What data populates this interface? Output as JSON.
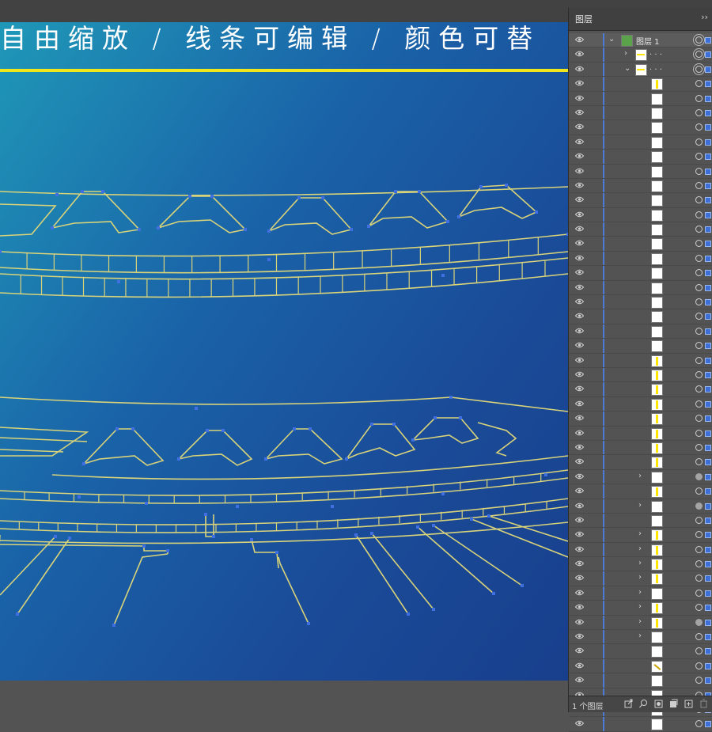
{
  "canvas": {
    "headline": "自由缩放 / 线条可编辑 / 颜色可替",
    "colors": {
      "line_yellow": "#f1e51c",
      "anchor_blue": "#3f6fe0",
      "bg_start": "#1f98b8",
      "bg_end": "#183f8c"
    }
  },
  "layers_panel": {
    "tab_label": "图层",
    "collapse_icon": "double-chevron-right-icon",
    "menu_icon": "panel-menu-icon",
    "top_layer_name": "图层 1",
    "group_name_dots": ". . .",
    "footer_label": "1 个图层",
    "footer_icons": [
      "export-icon",
      "locate-object-icon",
      "make-clipping-mask-icon",
      "new-sublayer-icon",
      "new-layer-icon",
      "delete-icon"
    ],
    "rows": [
      {
        "type": "layer",
        "twirl": "down",
        "target": "double"
      },
      {
        "type": "group",
        "twirl": "right",
        "target": "double"
      },
      {
        "type": "group",
        "twirl": "down",
        "target": "double"
      },
      {
        "type": "path",
        "twirl": "",
        "target": "ring",
        "thumb": "mark"
      },
      {
        "type": "path",
        "twirl": "",
        "target": "ring",
        "thumb": "plain"
      },
      {
        "type": "path",
        "twirl": "",
        "target": "ring",
        "thumb": "plain"
      },
      {
        "type": "path",
        "twirl": "",
        "target": "ring",
        "thumb": "plain"
      },
      {
        "type": "path",
        "twirl": "",
        "target": "ring",
        "thumb": "plain"
      },
      {
        "type": "path",
        "twirl": "",
        "target": "ring",
        "thumb": "plain"
      },
      {
        "type": "path",
        "twirl": "",
        "target": "ring",
        "thumb": "plain"
      },
      {
        "type": "path",
        "twirl": "",
        "target": "ring",
        "thumb": "plain"
      },
      {
        "type": "path",
        "twirl": "",
        "target": "ring",
        "thumb": "plain"
      },
      {
        "type": "path",
        "twirl": "",
        "target": "ring",
        "thumb": "plain"
      },
      {
        "type": "path",
        "twirl": "",
        "target": "ring",
        "thumb": "plain"
      },
      {
        "type": "path",
        "twirl": "",
        "target": "ring",
        "thumb": "plain"
      },
      {
        "type": "path",
        "twirl": "",
        "target": "ring",
        "thumb": "plain"
      },
      {
        "type": "path",
        "twirl": "",
        "target": "ring",
        "thumb": "plain"
      },
      {
        "type": "path",
        "twirl": "",
        "target": "ring",
        "thumb": "plain"
      },
      {
        "type": "path",
        "twirl": "",
        "target": "ring",
        "thumb": "plain"
      },
      {
        "type": "path",
        "twirl": "",
        "target": "ring",
        "thumb": "plain"
      },
      {
        "type": "path",
        "twirl": "",
        "target": "ring",
        "thumb": "plain"
      },
      {
        "type": "path",
        "twirl": "",
        "target": "ring",
        "thumb": "plain"
      },
      {
        "type": "path",
        "twirl": "",
        "target": "ring",
        "thumb": "mark"
      },
      {
        "type": "path",
        "twirl": "",
        "target": "ring",
        "thumb": "mark"
      },
      {
        "type": "path",
        "twirl": "",
        "target": "ring",
        "thumb": "mark"
      },
      {
        "type": "path",
        "twirl": "",
        "target": "ring",
        "thumb": "mark"
      },
      {
        "type": "path",
        "twirl": "",
        "target": "ring",
        "thumb": "mark"
      },
      {
        "type": "path",
        "twirl": "",
        "target": "ring",
        "thumb": "mark"
      },
      {
        "type": "path",
        "twirl": "",
        "target": "ring",
        "thumb": "mark"
      },
      {
        "type": "path",
        "twirl": "",
        "target": "ring",
        "thumb": "mark"
      },
      {
        "type": "group",
        "twirl": "right",
        "target": "filled",
        "thumb": "plain"
      },
      {
        "type": "path",
        "twirl": "",
        "target": "ring",
        "thumb": "mark"
      },
      {
        "type": "group",
        "twirl": "right",
        "target": "filled",
        "thumb": "plain"
      },
      {
        "type": "path",
        "twirl": "",
        "target": "ring",
        "thumb": "plain"
      },
      {
        "type": "group",
        "twirl": "right",
        "target": "ring",
        "thumb": "mark"
      },
      {
        "type": "group",
        "twirl": "right",
        "target": "ring",
        "thumb": "mark"
      },
      {
        "type": "group",
        "twirl": "right",
        "target": "ring",
        "thumb": "mark"
      },
      {
        "type": "group",
        "twirl": "right",
        "target": "ring",
        "thumb": "mark"
      },
      {
        "type": "group",
        "twirl": "right",
        "target": "ring",
        "thumb": "plain"
      },
      {
        "type": "group",
        "twirl": "right",
        "target": "ring",
        "thumb": "mark"
      },
      {
        "type": "group",
        "twirl": "right",
        "target": "filled",
        "thumb": "mark"
      },
      {
        "type": "group",
        "twirl": "right",
        "target": "ring",
        "thumb": "plain"
      },
      {
        "type": "path",
        "twirl": "",
        "target": "ring",
        "thumb": "plain"
      },
      {
        "type": "path",
        "twirl": "",
        "target": "ring",
        "thumb": "slash"
      },
      {
        "type": "path",
        "twirl": "",
        "target": "ring",
        "thumb": "plain"
      },
      {
        "type": "path",
        "twirl": "",
        "target": "ring",
        "thumb": "plain"
      },
      {
        "type": "path",
        "twirl": "",
        "target": "ring",
        "thumb": "plain"
      },
      {
        "type": "path",
        "twirl": "",
        "target": "ring",
        "thumb": "plain"
      }
    ]
  }
}
